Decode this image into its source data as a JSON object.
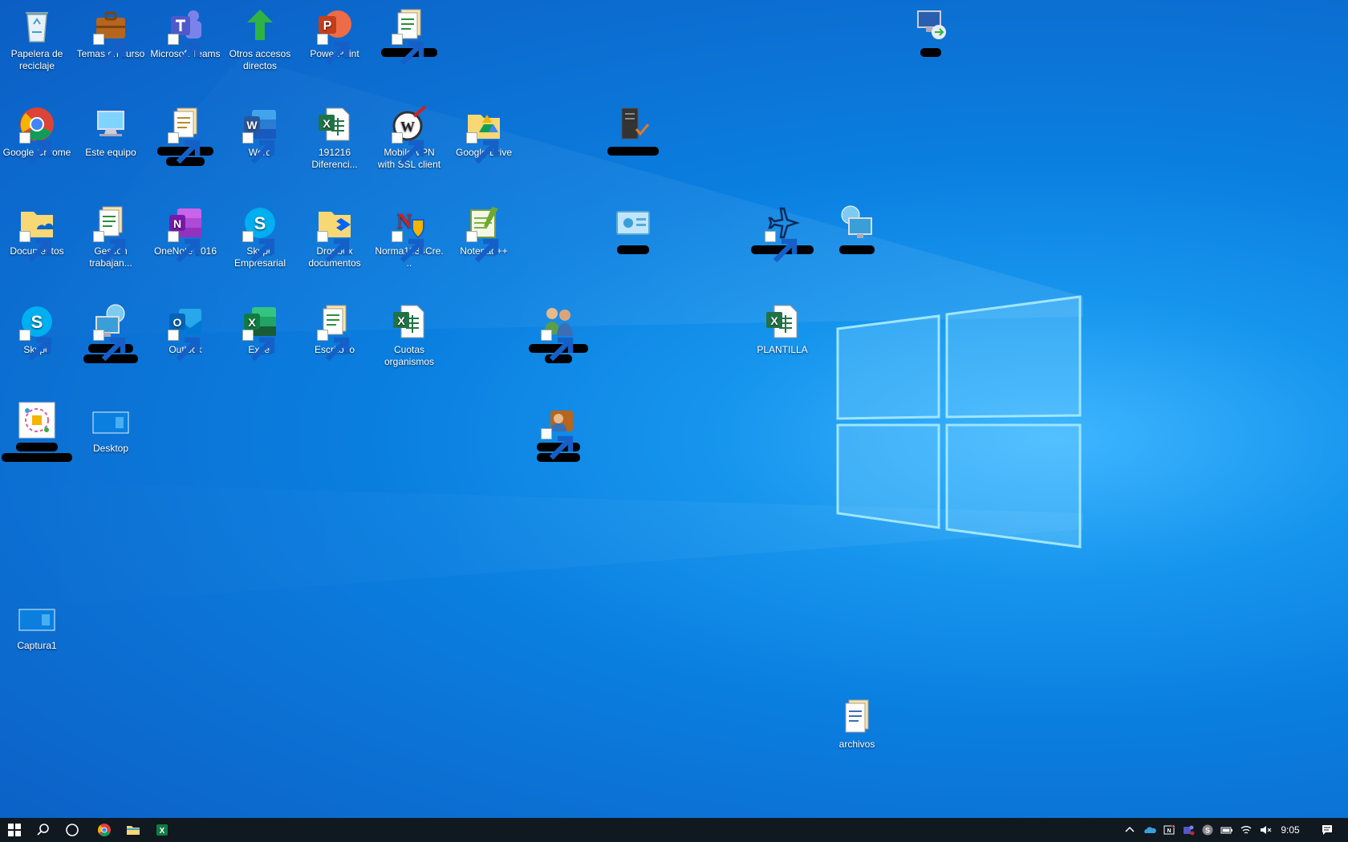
{
  "desktop": {
    "icons": {
      "recycle_bin": "Papelera de reciclaje",
      "temas": "Temas en curso",
      "teams": "Microsoft Teams",
      "otros": "Otros accesos directos",
      "powerpoint": "PowerPoint",
      "chrome": "Google Chrome",
      "este_equipo": "Este equipo",
      "word": "Word",
      "excel_191216": "191216 Diferenci...",
      "vpn": "Mobile VPN with SSL client",
      "gdrive": "Google Drive",
      "documentos": "Documentos",
      "gestion": "Gestión trabajan...",
      "onenote": "OneNote 2016",
      "skype_emp": "Skype Empresarial",
      "dropbox": "Dropbox documentos",
      "norma": "Norma1934Cre...",
      "notepad": "Notepad++",
      "skype": "Skype",
      "outlook": "Outlook",
      "excel": "Excel",
      "escritorio": "Escritorio",
      "cuotas": "Cuotas organismos",
      "plantilla": "PLANTILLA",
      "desktop": "Desktop",
      "captura": "Captura1",
      "archivos": "archivos"
    }
  },
  "taskbar": {
    "clock": "9:05"
  },
  "colors": {
    "taskbar_bg": "#101820",
    "desktop_blue": "#0a7fe0",
    "word": "#2b579a",
    "excel": "#217346",
    "powerpoint": "#d24726",
    "onenote": "#7719aa",
    "teams": "#5059c9",
    "skype": "#00aff0",
    "folder": "#f8d775"
  },
  "icon_names": [
    "recycle-bin-icon",
    "briefcase-icon",
    "teams-icon",
    "green-arrow-icon",
    "powerpoint-icon",
    "file-stack-icon",
    "chrome-icon",
    "monitor-icon",
    "word-icon",
    "excel-icon",
    "vpn-icon",
    "google-drive-icon",
    "folder-icon",
    "onenote-icon",
    "skype-icon",
    "dropbox-icon",
    "notepad-icon",
    "outlook-icon",
    "people-icon",
    "airplane-icon",
    "network-icon",
    "server-icon",
    "start-icon",
    "search-icon",
    "cortana-icon"
  ]
}
